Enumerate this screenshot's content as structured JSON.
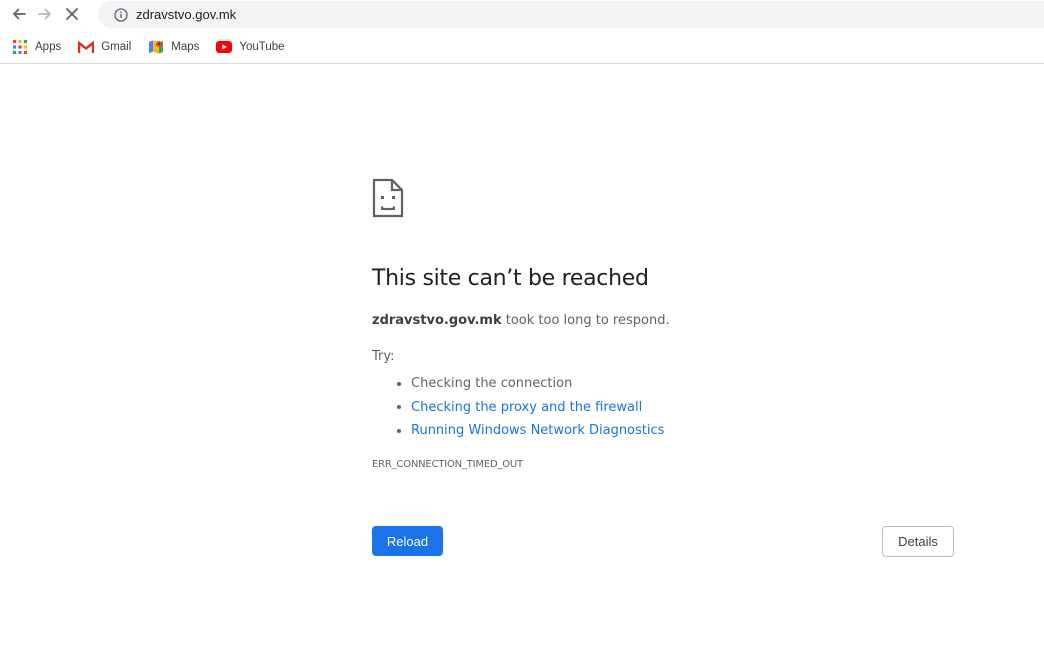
{
  "toolbar": {
    "back_icon": "arrow-left-icon",
    "forward_icon": "arrow-right-icon",
    "stop_icon": "close-icon",
    "info_icon": "info-icon",
    "url": "zdravstvo.gov.mk"
  },
  "bookmarks": [
    {
      "label": "Apps",
      "icon": "apps-grid-icon"
    },
    {
      "label": "Gmail",
      "icon": "gmail-icon"
    },
    {
      "label": "Maps",
      "icon": "maps-icon"
    },
    {
      "label": "YouTube",
      "icon": "youtube-icon"
    }
  ],
  "error": {
    "icon": "sad-page-icon",
    "heading": "This site can’t be reached",
    "host": "zdravstvo.gov.mk",
    "summary_rest": " took too long to respond.",
    "try_label": "Try:",
    "suggestions": [
      {
        "text": "Checking the connection",
        "link": false
      },
      {
        "text": "Checking the proxy and the firewall",
        "link": true
      },
      {
        "text": "Running Windows Network Diagnostics",
        "link": true
      }
    ],
    "code": "ERR_CONNECTION_TIMED_OUT"
  },
  "buttons": {
    "reload_label": "Reload",
    "details_label": "Details"
  },
  "colors": {
    "accent": "#1a73e8",
    "text_secondary": "#5f6368",
    "omnibox_bg": "#f1f3f4"
  }
}
